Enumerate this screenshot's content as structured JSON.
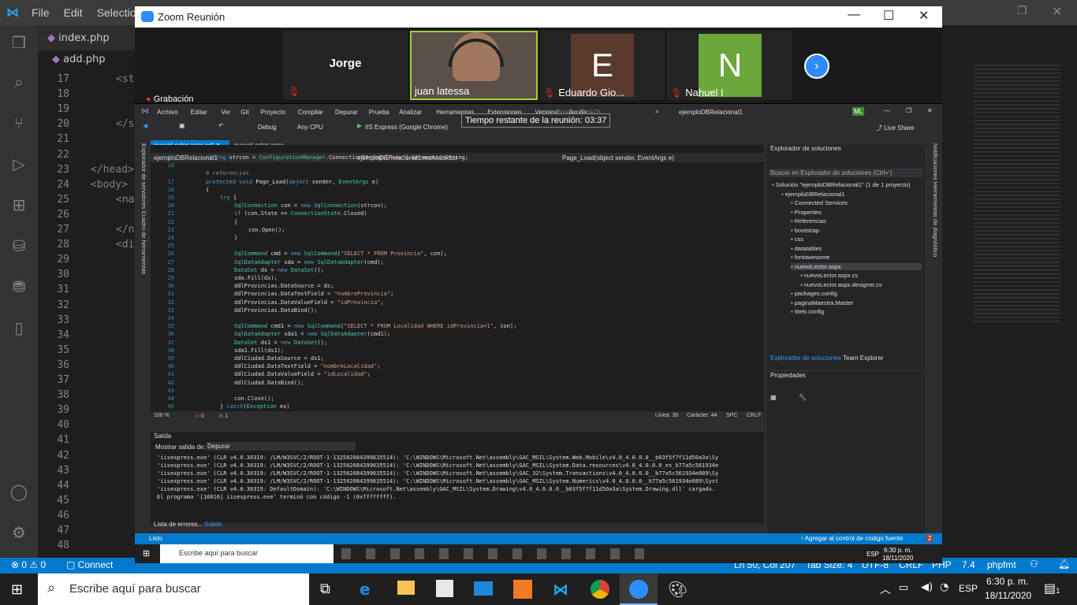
{
  "vscode": {
    "menu": [
      "File",
      "Edit",
      "Selection"
    ],
    "tab_index": "index.php",
    "tab_add": "add.php",
    "line_numbers": [
      "17",
      "18",
      "19",
      "20",
      "21",
      "22",
      "23",
      "24",
      "25",
      "26",
      "27",
      "28",
      "29",
      "30",
      "31",
      "32",
      "33",
      "34",
      "35",
      "36",
      "37",
      "38",
      "39",
      "40",
      "41",
      "42",
      "43",
      "44",
      "45",
      "46",
      "47",
      "48"
    ],
    "code_fragments": [
      {
        "text": "<st",
        "line": 0,
        "indent": 2
      },
      {
        "text": "</s",
        "line": 3,
        "indent": 2
      },
      {
        "text": "</head>",
        "line": 6,
        "indent": 0
      },
      {
        "text": "<body>",
        "line": 7,
        "indent": 0
      },
      {
        "text": "<na",
        "line": 8,
        "indent": 2
      },
      {
        "text": "</n",
        "line": 10,
        "indent": 2
      },
      {
        "text": "<di",
        "line": 11,
        "indent": 2
      }
    ],
    "status": {
      "errors": "0",
      "warnings": "0",
      "connect": "Connect",
      "position": "Ln 50, Col 207",
      "tab_size": "Tab Size: 4",
      "encoding": "UTF-8",
      "eol": "CRLF",
      "language": "PHP",
      "version": "7.4",
      "formatter": "phpfmt"
    }
  },
  "taskbar": {
    "search_placeholder": "Escribe aquí para buscar",
    "lang": "ESP",
    "time": "6:30 p. m.",
    "date": "18/11/2020",
    "notif_count": "1"
  },
  "zoom": {
    "title": "Zoom Reunión",
    "participants": [
      {
        "name": "Jorge",
        "muted": false,
        "initial": "",
        "color": "#242424"
      },
      {
        "name": "juan latessa",
        "muted": false,
        "initial": "",
        "color": "#3a3a3a"
      },
      {
        "name": "Eduardo Gio...",
        "muted": true,
        "initial": "E",
        "color": "#5a3a2c"
      },
      {
        "name": "Nahuel I",
        "muted": true,
        "initial": "N",
        "color": "#6aa63a"
      }
    ],
    "recording": "Grabación",
    "time_left": "Tiempo restante de la reunión: 03:37"
  },
  "inner_vs": {
    "menu": [
      "Archivo",
      "Editar",
      "Ver",
      "Git",
      "Proyecto",
      "Compilar",
      "Depurar",
      "Prueba",
      "Analizar",
      "Herramientas",
      "Extensiones",
      "Ventana",
      "Ayuda"
    ],
    "search": "Buscar (Ctrl+Q)",
    "solution_name": "ejemploDBRelacional1",
    "user": "ML",
    "live_share": "Live Share",
    "toolbar_config": "Debug",
    "toolbar_cpu": "Any CPU",
    "toolbar_run": "IIS Express (Google Chrome)",
    "tabs": [
      "nuevoLector.aspx.cs*",
      "nuevoLector.aspx"
    ],
    "nav_project": "ejemploDBRelacional1",
    "nav_class": "ejemploDBRelacional1.nuevoLector",
    "nav_method": "Page_Load(object sender, EventArgs e)",
    "side_left": [
      "Explorador de servidores",
      "Cuadro de herramientas"
    ],
    "side_right": [
      "Notificaciones",
      "Herramientas de diagnóstico"
    ],
    "code_lines": [
      {
        "n": "15",
        "t": "string strcon = ConfigurationManager.ConnectionStrings[\"con\"].ConnectionString;",
        "i": 1
      },
      {
        "n": "16",
        "t": "",
        "i": 0
      },
      {
        "n": "",
        "t": "0 referencias",
        "i": 1
      },
      {
        "n": "17",
        "t": "protected void Page_Load(object sender, EventArgs e)",
        "i": 1
      },
      {
        "n": "18",
        "t": "{",
        "i": 1
      },
      {
        "n": "19",
        "t": "try {",
        "i": 2
      },
      {
        "n": "20",
        "t": "SqlConnection con = new SqlConnection(strcon);",
        "i": 3
      },
      {
        "n": "21",
        "t": "if (con.State == ConnectionState.Closed)",
        "i": 3
      },
      {
        "n": "22",
        "t": "{",
        "i": 3
      },
      {
        "n": "23",
        "t": "con.Open();",
        "i": 4
      },
      {
        "n": "24",
        "t": "}",
        "i": 3
      },
      {
        "n": "25",
        "t": "",
        "i": 0
      },
      {
        "n": "26",
        "t": "SqlCommand cmd = new SqlCommand(\"SELECT * FROM Provincia\", con);",
        "i": 3
      },
      {
        "n": "27",
        "t": "SqlDataAdapter sda = new SqlDataAdapter(cmd);",
        "i": 3
      },
      {
        "n": "28",
        "t": "DataSet ds = new DataSet();",
        "i": 3
      },
      {
        "n": "29",
        "t": "sda.Fill(ds);",
        "i": 3
      },
      {
        "n": "30",
        "t": "ddlProvincias.DataSource = ds;",
        "i": 3
      },
      {
        "n": "31",
        "t": "ddlProvincias.DataTextField = \"nombreProvincia\";",
        "i": 3
      },
      {
        "n": "32",
        "t": "ddlProvincias.DataValueField = \"idProvincia\";",
        "i": 3
      },
      {
        "n": "33",
        "t": "ddlProvincias.DataBind();",
        "i": 3
      },
      {
        "n": "34",
        "t": "",
        "i": 0
      },
      {
        "n": "35",
        "t": "SqlCommand cmd1 = new SqlCommand(\"SELECT * FROM Localidad WHERE idProvincia=1\", con);",
        "i": 3
      },
      {
        "n": "36",
        "t": "SqlDataAdapter sda1 = new SqlDataAdapter(cmd1);",
        "i": 3
      },
      {
        "n": "37",
        "t": "DataSet ds1 = new DataSet();",
        "i": 3
      },
      {
        "n": "38",
        "t": "sda1.Fill(ds1);",
        "i": 3
      },
      {
        "n": "39",
        "t": "ddlCiudad.DataSource = ds1;",
        "i": 3
      },
      {
        "n": "40",
        "t": "ddlCiudad.DataTextField = \"nombreLocalidad\";",
        "i": 3
      },
      {
        "n": "41",
        "t": "ddlCiudad.DataValueField = \"idLocalidad\";",
        "i": 3
      },
      {
        "n": "42",
        "t": "ddlCiudad.DataBind();",
        "i": 3
      },
      {
        "n": "43",
        "t": "",
        "i": 0
      },
      {
        "n": "44",
        "t": "con.Close();",
        "i": 3
      },
      {
        "n": "45",
        "t": "} catch(Exception ex)",
        "i": 2
      }
    ],
    "editor_status": {
      "zoom": "100 %",
      "errors": "0",
      "warnings": "1",
      "line": "Línea: 39",
      "char": "Carácter: 44",
      "spc": "SPC",
      "crlf": "CRLF"
    },
    "output_title": "Salida",
    "output_show": "Mostrar salida de:",
    "output_source": "Depurar",
    "output_lines": [
      "'iisexpress.exe' (CLR v4.0.30319: /LM/W3SVC/2/ROOT-1-132502084399635514): 'C:\\WINDOWS\\Microsoft.Net\\assembly\\GAC_MSIL\\System.Web.Mobile\\v4.0_4.0.0.0__b03f5f7f11d50a3a\\Sy",
      "'iisexpress.exe' (CLR v4.0.30319: /LM/W3SVC/2/ROOT-1-132502084399635514): 'C:\\WINDOWS\\Microsoft.Net\\assembly\\GAC_MSIL\\System.Data.resources\\v4.0_4.0.0.0_es_b77a5c561934e",
      "'iisexpress.exe' (CLR v4.0.30319: /LM/W3SVC/2/ROOT-1-132502084399635514): 'C:\\WINDOWS\\Microsoft.Net\\assembly\\GAC_32\\System.Transactions\\v4.0_4.0.0.0__b77a5c561934e089\\Sy",
      "'iisexpress.exe' (CLR v4.0.30319: /LM/W3SVC/2/ROOT-1-132502084399635514): 'C:\\WINDOWS\\Microsoft.Net\\assembly\\GAC_MSIL\\System.Numerics\\v4.0_4.0.0.0__b77a5c561934e089\\Syst",
      "'iisexpress.exe' (CLR v4.0.30319: DefaultDomain): 'C:\\WINDOWS\\Microsoft.Net\\assembly\\GAC_MSIL\\System.Drawing\\v4.0_4.0.0.0__b03f5f7f11d50a3a\\System.Drawing.dll' cargado.",
      "El programa '[16016] iisexpress.exe' terminó con código -1 (0xffffffff)."
    ],
    "bottom_tabs": [
      "Lista de errores...",
      "Salida"
    ],
    "solution_title": "Explorador de soluciones",
    "solution_search": "Buscar en Explorador de soluciones (Ctrl+')",
    "solution_items": [
      {
        "t": "Solución \"ejemploDBRelacional1\" (1 de 1 proyecto)",
        "l": 0
      },
      {
        "t": "ejemploDBRelacional1",
        "l": 1
      },
      {
        "t": "Connected Services",
        "l": 2
      },
      {
        "t": "Properties",
        "l": 2
      },
      {
        "t": "Referencias",
        "l": 2
      },
      {
        "t": "bootstrap",
        "l": 2
      },
      {
        "t": "css",
        "l": 2
      },
      {
        "t": "datatables",
        "l": 2
      },
      {
        "t": "fontawesome",
        "l": 2
      },
      {
        "t": "nuevoLector.aspx",
        "l": 2
      },
      {
        "t": "nuevoLector.aspx.cs",
        "l": 3
      },
      {
        "t": "nuevoLector.aspx.designer.cs",
        "l": 3
      },
      {
        "t": "packages.config",
        "l": 2
      },
      {
        "t": "paginaMaestra.Master",
        "l": 2
      },
      {
        "t": "Web.config",
        "l": 2
      }
    ],
    "solution_tabs": [
      "Explorador de soluciones",
      "Team Explorer"
    ],
    "props_title": "Propiedades",
    "status_ready": "Listo",
    "status_source_control": "Agregar al control de código fuente",
    "status_notif": "2",
    "task_search": "Escribe aquí para buscar",
    "task_lang": "ESP",
    "task_time": "6:30 p. m.",
    "task_date": "18/11/2020"
  }
}
